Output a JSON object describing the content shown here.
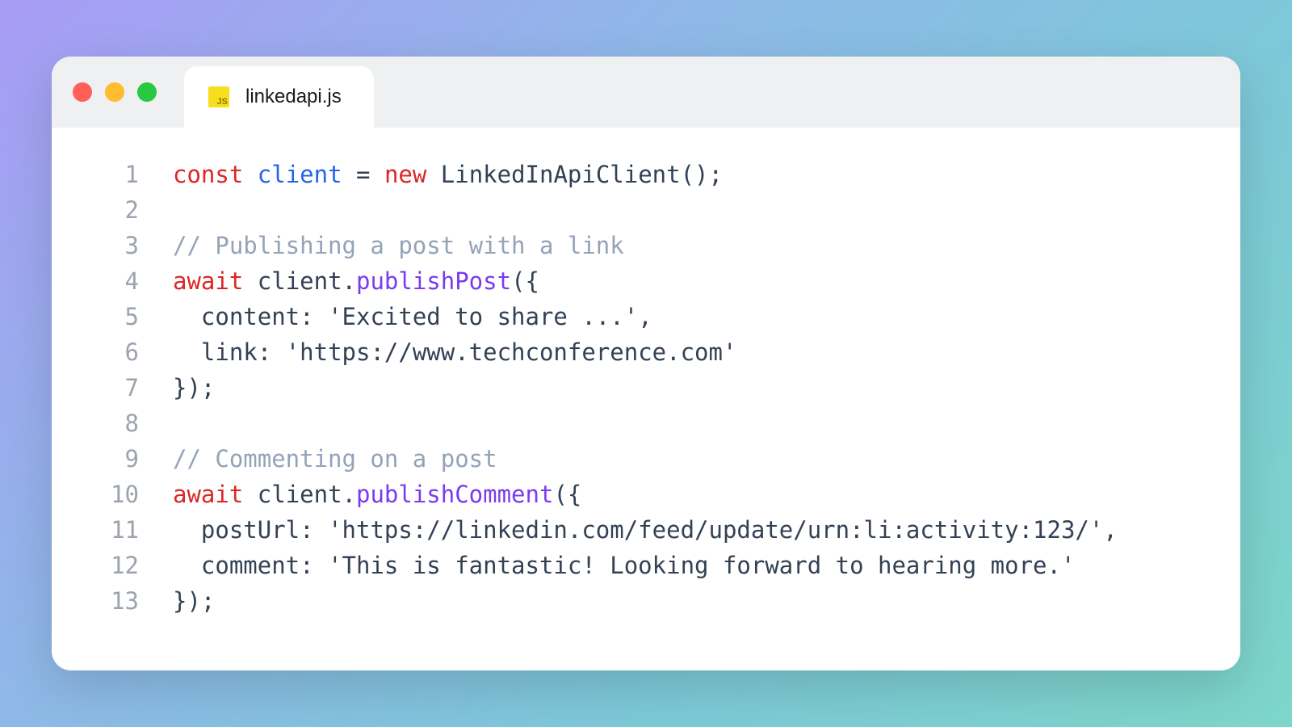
{
  "tab": {
    "filename": "linkedapi.js",
    "icon_label": "JS"
  },
  "traffic": {
    "close": "red",
    "min": "yellow",
    "max": "green"
  },
  "code": {
    "line_numbers": [
      "1",
      "2",
      "3",
      "4",
      "5",
      "6",
      "7",
      "8",
      "9",
      "10",
      "11",
      "12",
      "13"
    ],
    "l1": {
      "kw_const": "const",
      "ident": "client",
      "eq": " = ",
      "kw_new": "new",
      "ctor": " LinkedInApiClient();"
    },
    "l3": {
      "comment": "// Publishing a post with a link"
    },
    "l4": {
      "kw_await": "await",
      "sp": " ",
      "obj": "client.",
      "method": "publishPost",
      "tail": "({"
    },
    "l5": {
      "indent": "  ",
      "prop": "content:",
      "sp": " ",
      "str": "'Excited to share ...'",
      "comma": ","
    },
    "l6": {
      "indent": "  ",
      "prop": "link:",
      "sp": " ",
      "str": "'https://www.techconference.com'"
    },
    "l7": {
      "close": "});"
    },
    "l9": {
      "comment": "// Commenting on a post"
    },
    "l10": {
      "kw_await": "await",
      "sp": " ",
      "obj": "client.",
      "method": "publishComment",
      "tail": "({"
    },
    "l11": {
      "indent": "  ",
      "prop": "postUrl:",
      "sp": " ",
      "str": "'https://linkedin.com/feed/update/urn:li:activity:123/'",
      "comma": ","
    },
    "l12": {
      "indent": "  ",
      "prop": "comment:",
      "sp": " ",
      "str": "'This is fantastic! Looking forward to hearing more.'"
    },
    "l13": {
      "close": "});"
    }
  }
}
